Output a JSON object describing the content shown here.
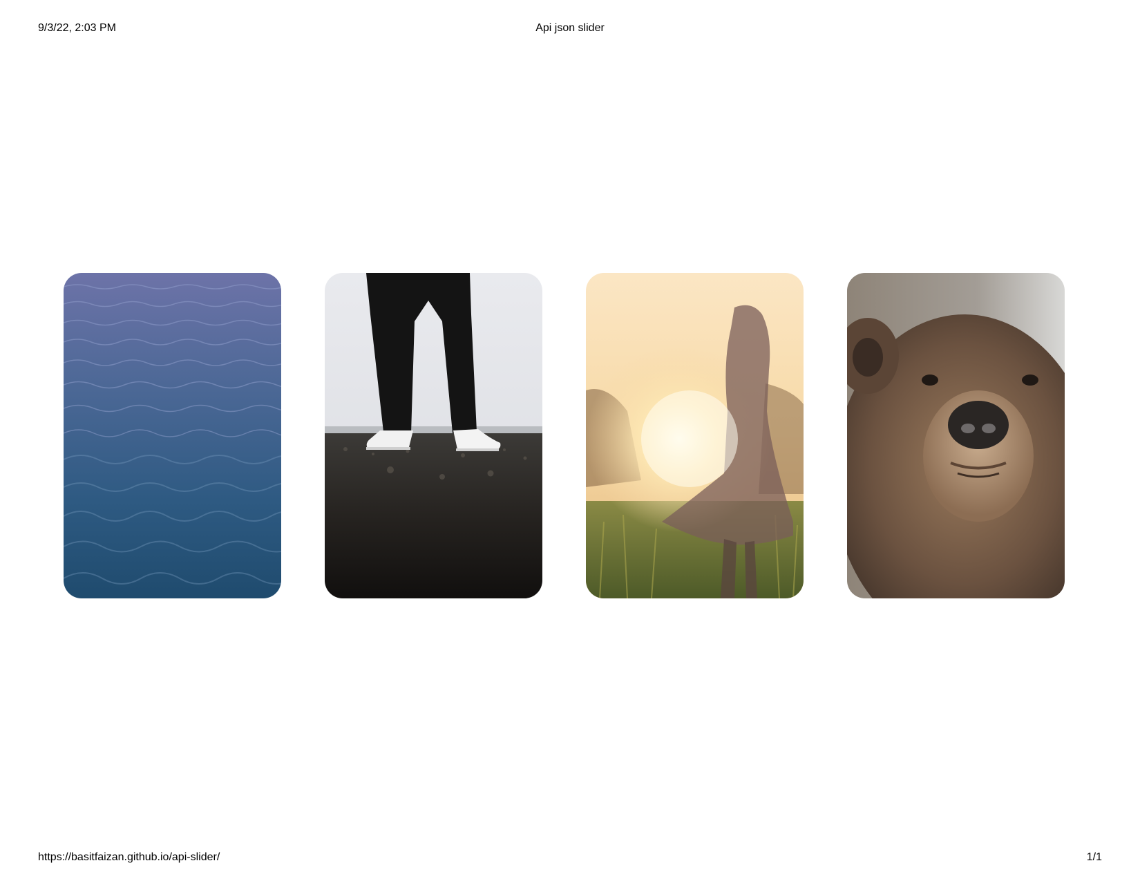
{
  "header": {
    "timestamp": "9/3/22, 2:03 PM",
    "title": "Api json slider"
  },
  "footer": {
    "url": "https://basitfaizan.github.io/api-slider/",
    "page_number": "1/1"
  },
  "slides": [
    {
      "name": "ocean-water-photo"
    },
    {
      "name": "legs-sneakers-photo"
    },
    {
      "name": "sunset-girl-photo"
    },
    {
      "name": "bear-face-photo"
    }
  ]
}
